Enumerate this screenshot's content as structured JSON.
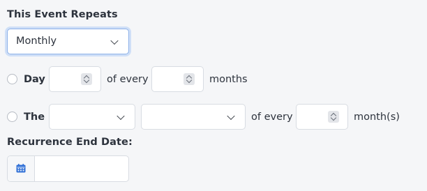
{
  "recurrence": {
    "heading": "This Event Repeats",
    "frequency_select": {
      "value": "Monthly"
    },
    "option_day": {
      "label": "Day",
      "day_value": "",
      "of_every_label": "of every",
      "months_value": "",
      "unit_label": "months"
    },
    "option_the": {
      "label": "The",
      "ordinal_value": "",
      "weekday_value": "",
      "of_every_label": "of every",
      "months_value": "",
      "unit_label": "month(s)"
    },
    "end_date": {
      "heading": "Recurrence End Date:",
      "value": "",
      "icon": "calendar-icon"
    }
  },
  "colors": {
    "background": "#f5f6f8",
    "focus_ring": "#cfdff7",
    "calendar_icon": "#2f6fd6"
  }
}
